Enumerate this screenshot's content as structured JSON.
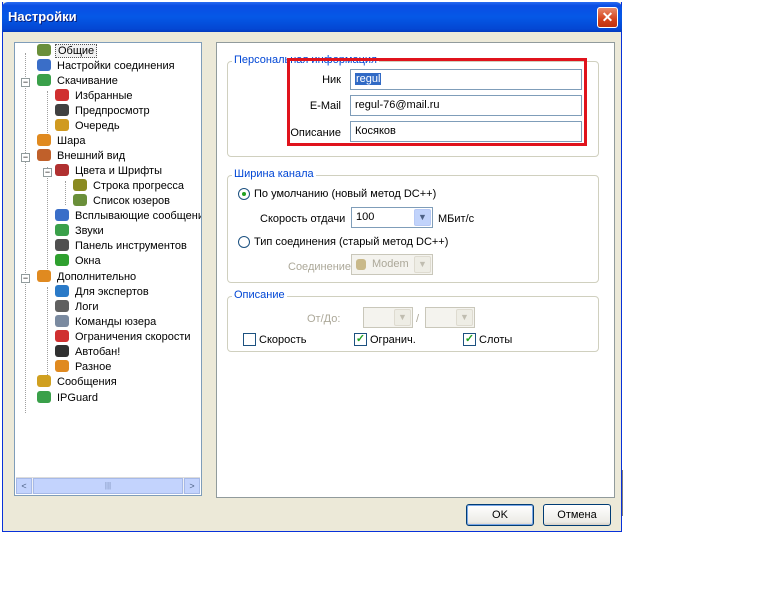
{
  "window": {
    "title": "Настройки"
  },
  "tree": {
    "items": [
      {
        "label": "Общие",
        "icon": "users-icon",
        "color": "#6a8f3a"
      },
      {
        "label": "Настройки соединения",
        "icon": "network-icon",
        "color": "#3a6ec8"
      },
      {
        "label": "Скачивание",
        "icon": "download-icon",
        "color": "#3aa04a"
      },
      {
        "label": "Избранные",
        "icon": "heart-icon",
        "color": "#d03030"
      },
      {
        "label": "Предпросмотр",
        "icon": "preview-icon",
        "color": "#404040"
      },
      {
        "label": "Очередь",
        "icon": "queue-icon",
        "color": "#d09a20"
      },
      {
        "label": "Шара",
        "icon": "share-icon",
        "color": "#e08a20"
      },
      {
        "label": "Внешний вид",
        "icon": "appearance-icon",
        "color": "#c0602a"
      },
      {
        "label": "Цвета и Шрифты",
        "icon": "palette-icon",
        "color": "#b03030"
      },
      {
        "label": "Строка прогресса",
        "icon": "progress-icon",
        "color": "#8a8a20"
      },
      {
        "label": "Список юзеров",
        "icon": "userlist-icon",
        "color": "#6a8f3a"
      },
      {
        "label": "Всплывающие сообщения",
        "icon": "popup-icon",
        "color": "#3a6ec8"
      },
      {
        "label": "Звуки",
        "icon": "sound-icon",
        "color": "#3aa04a"
      },
      {
        "label": "Панель инструментов",
        "icon": "toolbar-icon",
        "color": "#505050"
      },
      {
        "label": "Окна",
        "icon": "windows-icon",
        "color": "#2fa02f"
      },
      {
        "label": "Дополнительно",
        "icon": "advanced-icon",
        "color": "#e08a20"
      },
      {
        "label": "Для экспертов",
        "icon": "expert-icon",
        "color": "#2a7ac8"
      },
      {
        "label": "Логи",
        "icon": "log-icon",
        "color": "#606060"
      },
      {
        "label": "Команды юзера",
        "icon": "commands-icon",
        "color": "#7a8aa0"
      },
      {
        "label": "Ограничения скорости",
        "icon": "speed-limit-icon",
        "color": "#d03030"
      },
      {
        "label": "Автобан!",
        "icon": "autoban-icon",
        "color": "#303030"
      },
      {
        "label": "Разное",
        "icon": "misc-icon",
        "color": "#e08a20"
      },
      {
        "label": "Сообщения",
        "icon": "messages-icon",
        "color": "#d0a020"
      },
      {
        "label": "IPGuard",
        "icon": "ipguard-icon",
        "color": "#3aa04a"
      }
    ],
    "collapse_sign": "−",
    "scroll_left": "<",
    "scroll_right": ">",
    "scroll_grip": "|||"
  },
  "personal": {
    "legend": "Персональная информация",
    "nick_label": "Ник",
    "nick_value": "regul",
    "email_label": "E-Mail",
    "email_value": "regul-76@mail.ru",
    "desc_label": "Описание",
    "desc_value": "Косяков"
  },
  "bandwidth": {
    "legend": "Ширина канала",
    "default_label": "По умолчанию (новый метод DC++)",
    "upload_label": "Скорость отдачи",
    "upload_value": "100",
    "unit": "МБит/с",
    "conn_type_label": "Тип соединения (старый метод DC++)",
    "connection_label": "Соединение",
    "connection_value": "Modem",
    "arrow": "▼"
  },
  "description": {
    "legend": "Описание",
    "fromto_label": "От/До:",
    "slash": "/",
    "speed_label": "Скорость",
    "limit_label": "Огранич.",
    "slots_label": "Слоты",
    "check_mark": "✓"
  },
  "buttons": {
    "ok": "OK",
    "cancel": "Отмена"
  },
  "window_close": "✕"
}
